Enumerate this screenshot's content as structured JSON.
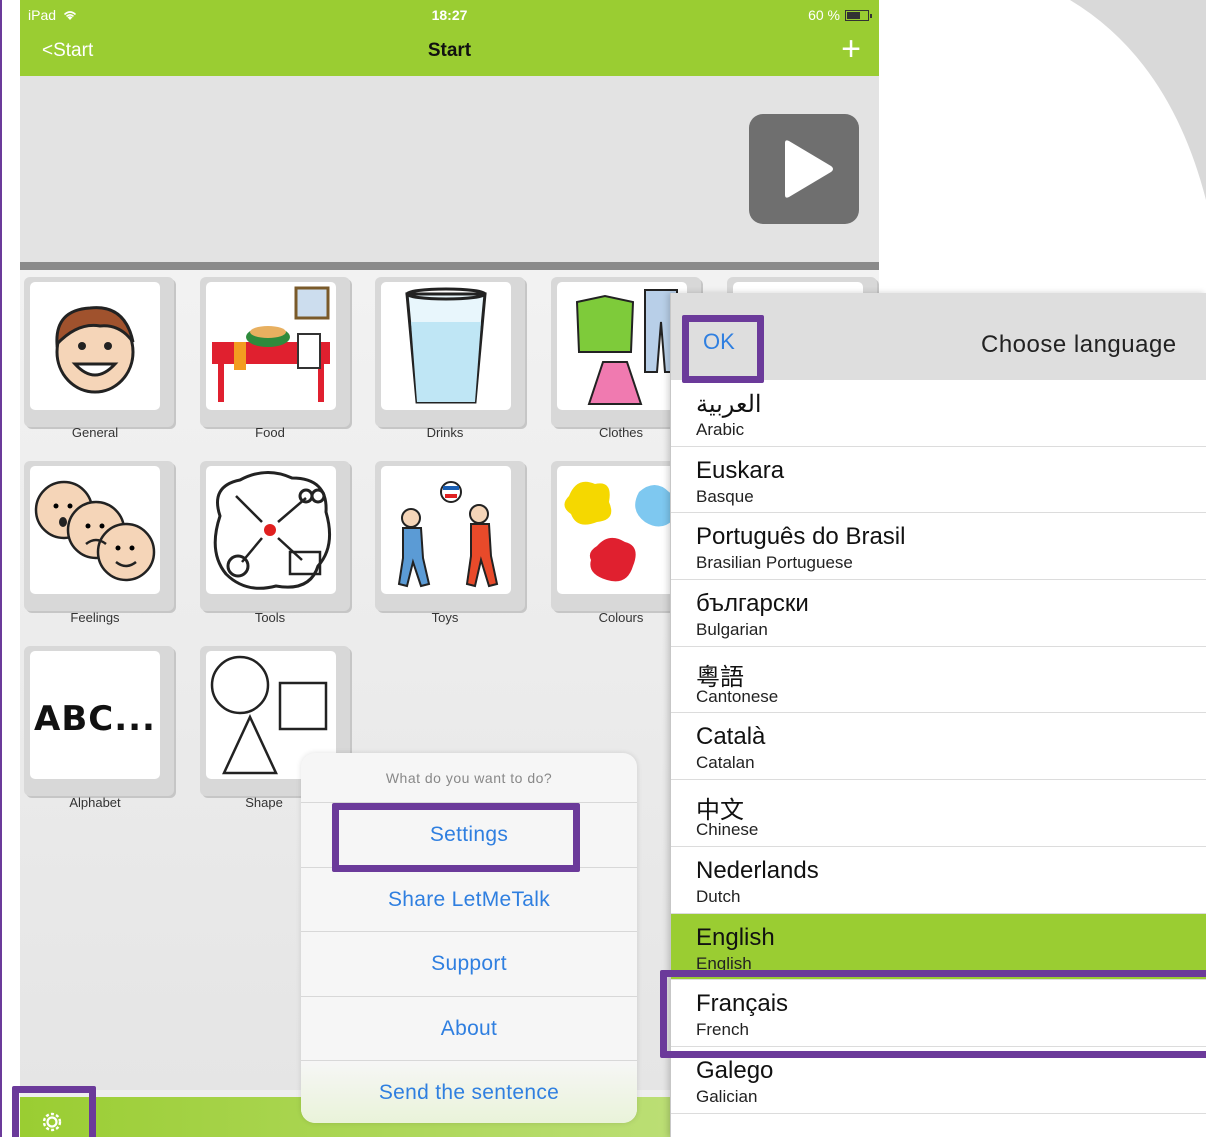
{
  "status_bar": {
    "device": "iPad",
    "time": "18:27",
    "battery": "60 %",
    "battery_level": 0.6
  },
  "nav": {
    "back_label": "<Start",
    "title": "Start",
    "add_label": "+"
  },
  "tiles": [
    {
      "label": "General"
    },
    {
      "label": "Food"
    },
    {
      "label": "Drinks"
    },
    {
      "label": "Clothes"
    },
    {
      "label": "Feelings"
    },
    {
      "label": "Tools"
    },
    {
      "label": "Toys"
    },
    {
      "label": "Colours"
    },
    {
      "label": "Alphabet",
      "symbol_text": "ABC..."
    },
    {
      "label": "Shape"
    }
  ],
  "action_sheet": {
    "title": "What do you want to do?",
    "items": [
      "Settings",
      "Share LetMeTalk",
      "Support",
      "About",
      "Send the sentence"
    ]
  },
  "language_panel": {
    "ok_label": "OK",
    "title": "Choose language",
    "languages": [
      {
        "native": "العربية",
        "english": "Arabic"
      },
      {
        "native": "Euskara",
        "english": "Basque"
      },
      {
        "native": "Português do Brasil",
        "english": "Brasilian Portuguese"
      },
      {
        "native": "български",
        "english": "Bulgarian"
      },
      {
        "native": "粵語",
        "english": "Cantonese"
      },
      {
        "native": "Català",
        "english": "Catalan"
      },
      {
        "native": "中文",
        "english": "Chinese"
      },
      {
        "native": "Nederlands",
        "english": "Dutch"
      },
      {
        "native": "English",
        "english": "English",
        "selected": true
      },
      {
        "native": "Français",
        "english": "French"
      },
      {
        "native": "Galego",
        "english": "Galician"
      }
    ]
  },
  "colors": {
    "accent_green": "#9acd32",
    "highlight_purple": "#6b3a9a",
    "link_blue": "#2f7fe0"
  }
}
